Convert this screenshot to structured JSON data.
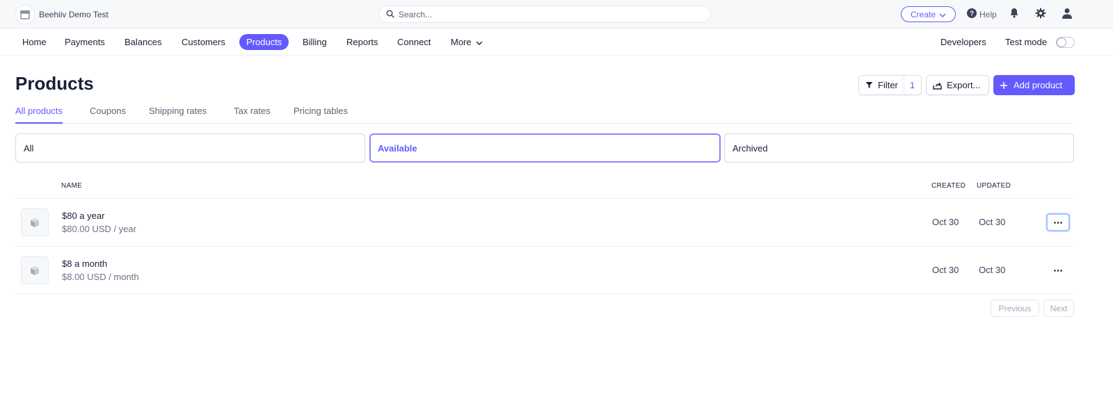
{
  "account": {
    "name": "Beehiiv Demo Test"
  },
  "search": {
    "placeholder": "Search..."
  },
  "topbar": {
    "create_label": "Create",
    "help_label": "Help"
  },
  "nav": {
    "items": [
      {
        "label": "Home"
      },
      {
        "label": "Payments"
      },
      {
        "label": "Balances"
      },
      {
        "label": "Customers"
      },
      {
        "label": "Products",
        "active": true
      },
      {
        "label": "Billing"
      },
      {
        "label": "Reports"
      },
      {
        "label": "Connect"
      },
      {
        "label": "More"
      }
    ],
    "developers_label": "Developers",
    "test_mode_label": "Test mode",
    "test_mode_on": false
  },
  "page": {
    "title": "Products",
    "filter_label": "Filter",
    "filter_count": "1",
    "export_label": "Export...",
    "add_label": "Add product"
  },
  "tabs": [
    {
      "label": "All products",
      "active": true
    },
    {
      "label": "Coupons"
    },
    {
      "label": "Shipping rates"
    },
    {
      "label": "Tax rates"
    },
    {
      "label": "Pricing tables"
    }
  ],
  "status_filters": [
    {
      "label": "All"
    },
    {
      "label": "Available",
      "active": true
    },
    {
      "label": "Archived"
    }
  ],
  "table": {
    "headers": {
      "name": "NAME",
      "created": "CREATED",
      "updated": "UPDATED"
    },
    "rows": [
      {
        "name": "$80 a year",
        "price": "$80.00 USD / year",
        "created": "Oct 30",
        "updated": "Oct 30"
      },
      {
        "name": "$8 a month",
        "price": "$8.00 USD / month",
        "created": "Oct 30",
        "updated": "Oct 30"
      }
    ]
  },
  "pagination": {
    "previous_label": "Previous",
    "next_label": "Next"
  },
  "colors": {
    "accent": "#635bff",
    "text": "#1a1f36",
    "muted": "#697386",
    "border": "#e3e8ee"
  }
}
